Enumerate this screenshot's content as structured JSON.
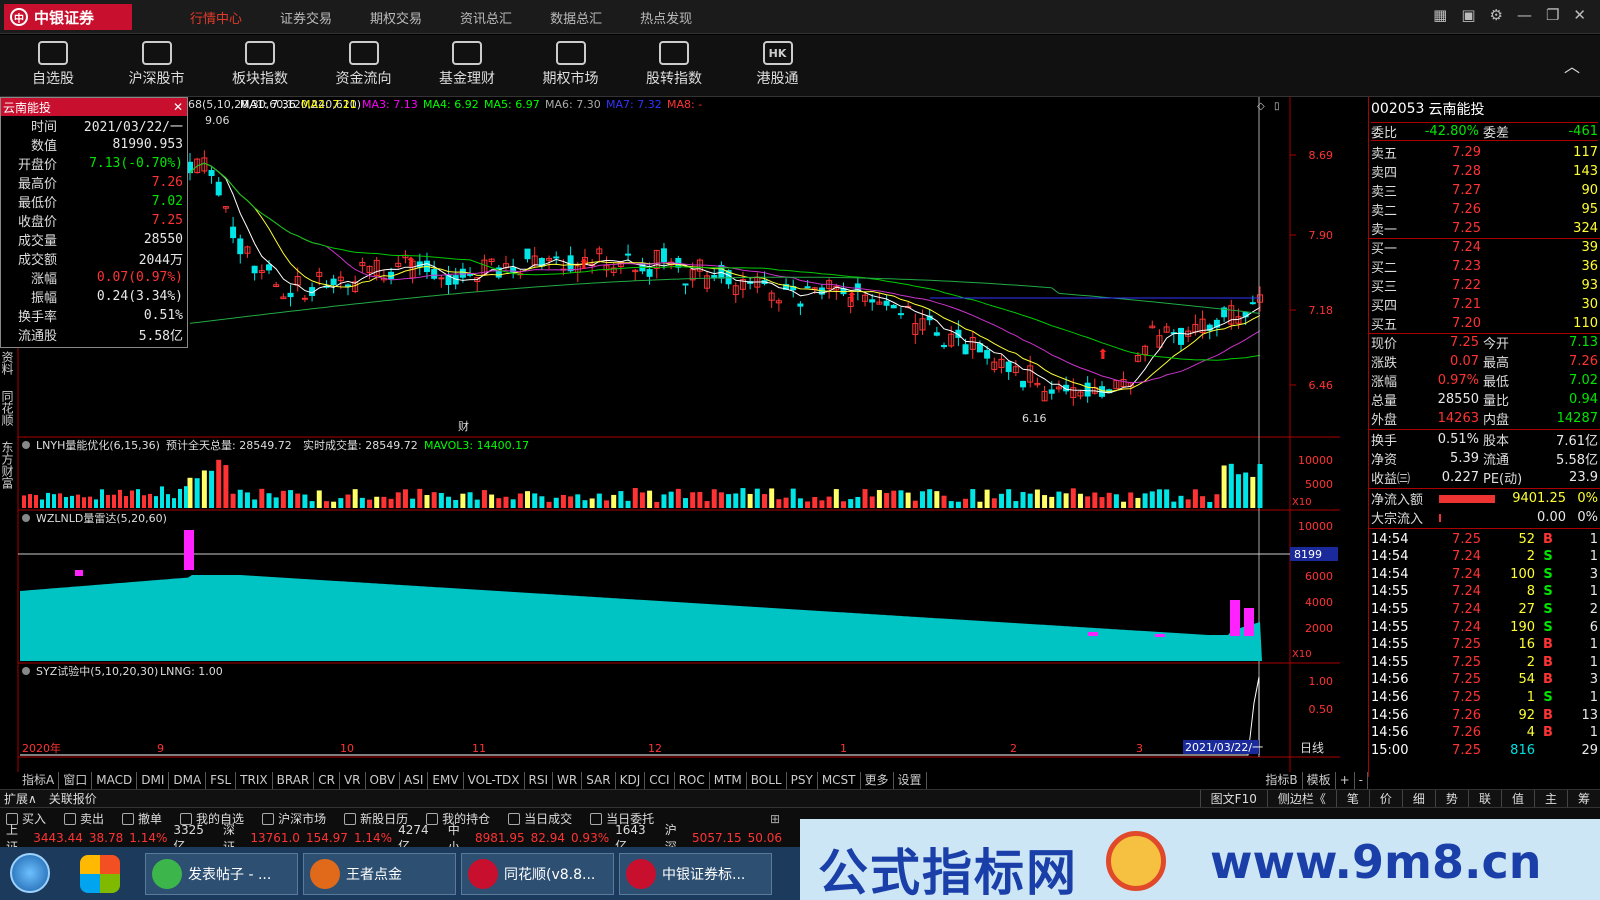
{
  "brand": {
    "name": "中银证券",
    "color": "#c8102e"
  },
  "topmenu": [
    {
      "label": "行情中心",
      "active": true
    },
    {
      "label": "证券交易"
    },
    {
      "label": "期权交易"
    },
    {
      "label": "资讯总汇"
    },
    {
      "label": "数据总汇"
    },
    {
      "label": "热点发现"
    }
  ],
  "window_icons": [
    "grid-icon",
    "chart-icon",
    "gear-icon",
    "minimize-icon",
    "restore-icon",
    "close-icon"
  ],
  "toolbar": [
    {
      "label": "自选股",
      "icon": "folder-heart-icon"
    },
    {
      "label": "沪深股市",
      "icon": "line-chart-icon"
    },
    {
      "label": "板块指数",
      "icon": "sector-chart-icon"
    },
    {
      "label": "资金流向",
      "icon": "yen-icon"
    },
    {
      "label": "基金理财",
      "icon": "fund-icon"
    },
    {
      "label": "期权市场",
      "icon": "option-chart-icon"
    },
    {
      "label": "股转指数",
      "icon": "bar-icon"
    },
    {
      "label": "港股通",
      "icon": "hk-icon",
      "text": "HK"
    }
  ],
  "main_chart": {
    "header": "68(5,10,20,30,60,120,240,610)",
    "ma_labels": [
      {
        "text": "MA1: 7.36",
        "color": "#ffffff"
      },
      {
        "text": "MA2: 7.21",
        "color": "#ffff00"
      },
      {
        "text": "MA3: 7.13",
        "color": "#ff00ff"
      },
      {
        "text": "MA4: 6.92",
        "color": "#00ff00"
      },
      {
        "text": "MA5: 6.97",
        "color": "#00ff00"
      },
      {
        "text": "MA6: 7.30",
        "color": "#aaaaaa"
      },
      {
        "text": "MA7: 7.32",
        "color": "#3333ff"
      },
      {
        "text": "MA8: -",
        "color": "#ff3333"
      }
    ],
    "price_axis": [
      "8.69",
      "7.90",
      "7.18",
      "6.46"
    ],
    "high_mark": "9.06",
    "low_mark": "6.16",
    "finance_mark": "财"
  },
  "infobox": {
    "title": "云南能投",
    "rows": [
      {
        "label": "时间",
        "value": "2021/03/22/一",
        "color": "white"
      },
      {
        "label": "数值",
        "value": "81990.953",
        "color": "white"
      },
      {
        "label": "开盘价",
        "value": "7.13(-0.70%)",
        "color": "green"
      },
      {
        "label": "最高价",
        "value": "7.26",
        "color": "red"
      },
      {
        "label": "最低价",
        "value": "7.02",
        "color": "green"
      },
      {
        "label": "收盘价",
        "value": "7.25",
        "color": "red"
      },
      {
        "label": "成交量",
        "value": "28550",
        "color": "white"
      },
      {
        "label": "成交额",
        "value": "2044万",
        "color": "white"
      },
      {
        "label": "涨幅",
        "value": "0.07(0.97%)",
        "color": "red"
      },
      {
        "label": "振幅",
        "value": "0.24(3.34%)",
        "color": "white"
      },
      {
        "label": "换手率",
        "value": "0.51%",
        "color": "white"
      },
      {
        "label": "流通股",
        "value": "5.58亿",
        "color": "white"
      }
    ]
  },
  "side_labels": [
    "资料",
    "同花顺10",
    "东方财富"
  ],
  "volume_panel": {
    "title": "LNYH量能优化(6,15,36)",
    "forecast": "预计全天总量: 28549.72",
    "realtime": "实时成交量: 28549.72",
    "mavol": "MAVOL3: 14400.17",
    "axis": [
      "10000",
      "5000"
    ],
    "scale": "X10"
  },
  "radar_panel": {
    "title": "WZLNLD量雷达(5,20,60)",
    "axis": [
      "10000",
      "8000",
      "6000",
      "4000",
      "2000"
    ],
    "marker": "8199",
    "scale": "X10"
  },
  "syz_panel": {
    "title": "SYZ试验中(5,10,20,30)",
    "lnng": "LNNG: 1.00",
    "axis": [
      "1.00",
      "0.50"
    ]
  },
  "date_axis": {
    "labels": [
      "2020年",
      "9",
      "10",
      "11",
      "12",
      "1",
      "2",
      "3"
    ],
    "current": "2021/03/22/一",
    "period": "日线"
  },
  "indicator_tabs": [
    "指标A",
    "窗口",
    "MACD",
    "DMI",
    "DMA",
    "FSL",
    "TRIX",
    "BRAR",
    "CR",
    "VR",
    "OBV",
    "ASI",
    "EMV",
    "VOL-TDX",
    "RSI",
    "WR",
    "SAR",
    "KDJ",
    "CCI",
    "ROC",
    "MTM",
    "BOLL",
    "PSY",
    "MCST",
    "更多",
    "设置"
  ],
  "indicator_right": [
    "指标B",
    "模板",
    "+",
    "-"
  ],
  "status_left": [
    "扩展∧",
    "关联报价"
  ],
  "status_right": [
    "图文F10",
    "侧边栏《",
    "笔",
    "价",
    "细",
    "势",
    "联",
    "值",
    "主",
    "筹"
  ],
  "stock": {
    "code": "002053",
    "name": "云南能投"
  },
  "weibi": {
    "label": "委比",
    "value": "-42.80%",
    "label2": "委差",
    "value2": "-461"
  },
  "sell": [
    {
      "label": "卖五",
      "price": "7.29",
      "vol": "117"
    },
    {
      "label": "卖四",
      "price": "7.28",
      "vol": "143"
    },
    {
      "label": "卖三",
      "price": "7.27",
      "vol": "90"
    },
    {
      "label": "卖二",
      "price": "7.26",
      "vol": "95"
    },
    {
      "label": "卖一",
      "price": "7.25",
      "vol": "324"
    }
  ],
  "buy": [
    {
      "label": "买一",
      "price": "7.24",
      "vol": "39"
    },
    {
      "label": "买二",
      "price": "7.23",
      "vol": "36"
    },
    {
      "label": "买三",
      "price": "7.22",
      "vol": "93"
    },
    {
      "label": "买四",
      "price": "7.21",
      "vol": "30"
    },
    {
      "label": "买五",
      "price": "7.20",
      "vol": "110"
    }
  ],
  "quote": [
    {
      "l1": "现价",
      "v1": "7.25",
      "c1": "red",
      "l2": "今开",
      "v2": "7.13",
      "c2": "green"
    },
    {
      "l1": "涨跌",
      "v1": "0.07",
      "c1": "red",
      "l2": "最高",
      "v2": "7.26",
      "c2": "red"
    },
    {
      "l1": "涨幅",
      "v1": "0.97%",
      "c1": "red",
      "l2": "最低",
      "v2": "7.02",
      "c2": "green"
    },
    {
      "l1": "总量",
      "v1": "28550",
      "c1": "white",
      "l2": "量比",
      "v2": "0.94",
      "c2": "green"
    },
    {
      "l1": "外盘",
      "v1": "14263",
      "c1": "red",
      "l2": "内盘",
      "v2": "14287",
      "c2": "green"
    }
  ],
  "quote2": [
    {
      "l1": "换手",
      "v1": "0.51%",
      "l2": "股本",
      "v2": "7.61亿"
    },
    {
      "l1": "净资",
      "v1": "5.39",
      "l2": "流通",
      "v2": "5.58亿"
    },
    {
      "l1": "收益㈢",
      "v1": "0.227",
      "l2": "PE(动)",
      "v2": "23.9"
    }
  ],
  "flow": [
    {
      "label": "净流入额",
      "value": "9401.25",
      "pct": "0%"
    },
    {
      "label": "大宗流入",
      "value": "0.00",
      "pct": "0%"
    }
  ],
  "ticks": [
    {
      "t": "14:54",
      "p": "7.25",
      "v": "52",
      "d": "B",
      "n": "1"
    },
    {
      "t": "14:54",
      "p": "7.24",
      "v": "2",
      "d": "S",
      "n": "1"
    },
    {
      "t": "14:54",
      "p": "7.24",
      "v": "100",
      "d": "S",
      "n": "3"
    },
    {
      "t": "14:55",
      "p": "7.24",
      "v": "8",
      "d": "S",
      "n": "1"
    },
    {
      "t": "14:55",
      "p": "7.24",
      "v": "27",
      "d": "S",
      "n": "2"
    },
    {
      "t": "14:55",
      "p": "7.24",
      "v": "190",
      "d": "S",
      "n": "6"
    },
    {
      "t": "14:55",
      "p": "7.25",
      "v": "16",
      "d": "B",
      "n": "1"
    },
    {
      "t": "14:55",
      "p": "7.25",
      "v": "2",
      "d": "B",
      "n": "1"
    },
    {
      "t": "14:56",
      "p": "7.25",
      "v": "54",
      "d": "B",
      "n": "3"
    },
    {
      "t": "14:56",
      "p": "7.25",
      "v": "1",
      "d": "S",
      "n": "1"
    },
    {
      "t": "14:56",
      "p": "7.26",
      "v": "92",
      "d": "B",
      "n": "13"
    },
    {
      "t": "14:56",
      "p": "7.26",
      "v": "4",
      "d": "B",
      "n": "1"
    },
    {
      "t": "15:00",
      "p": "7.25",
      "v": "816",
      "d": "",
      "n": "29"
    }
  ],
  "actions": [
    {
      "label": "买入",
      "icon": "buy-icon"
    },
    {
      "label": "卖出",
      "icon": "sell-icon"
    },
    {
      "label": "撤单",
      "icon": "undo-icon"
    },
    {
      "label": "我的自选",
      "icon": "star-icon"
    },
    {
      "label": "沪深市场",
      "icon": "market-icon"
    },
    {
      "label": "新股日历",
      "icon": "calendar-icon"
    },
    {
      "label": "我的持仓",
      "icon": "holding-icon"
    },
    {
      "label": "当日成交",
      "icon": "deal-icon"
    },
    {
      "label": "当日委托",
      "icon": "order-icon"
    }
  ],
  "indices": [
    {
      "name": "上证",
      "v": "3443.44",
      "c": "38.78",
      "p": "1.14%",
      "a": "3325亿"
    },
    {
      "name": "深证",
      "v": "13761.0",
      "c": "154.97",
      "p": "1.14%",
      "a": "4274亿"
    },
    {
      "name": "中小",
      "v": "8981.95",
      "c": "82.94",
      "p": "0.93%",
      "a": "1643亿"
    },
    {
      "name": "沪深",
      "v": "5057.15",
      "c": "50.06",
      "p": "",
      "a": ""
    }
  ],
  "taskbar": [
    {
      "label": "发表帖子 - ..."
    },
    {
      "label": "王者点金"
    },
    {
      "label": "同花顺(v8.8..."
    },
    {
      "label": "中银证券标..."
    }
  ],
  "banner": {
    "title": "公式指标网",
    "url": "www.9m8.cn"
  }
}
